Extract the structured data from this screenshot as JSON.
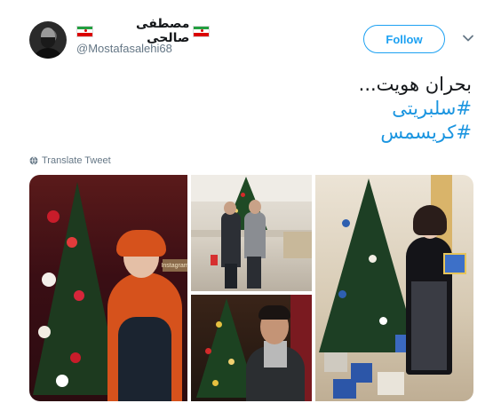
{
  "user": {
    "display_name": "مصطفی صالحی",
    "handle": "@Mostafasalehi68",
    "flag_icon": "iran-flag-icon"
  },
  "actions": {
    "follow_label": "Follow",
    "menu_icon": "chevron-down-icon"
  },
  "tweet": {
    "text": "بحران هویت...",
    "hashtags": [
      "#سلبریتی",
      "#کریسمس"
    ]
  },
  "translate": {
    "label": "Translate Tweet",
    "icon": "globe-icon"
  },
  "media": {
    "photos": [
      {
        "alt": "woman-with-orange-scarf-by-christmas-tree",
        "sign_text": "Instagram"
      },
      {
        "alt": "two-men-in-mall-with-christmas-tree"
      },
      {
        "alt": "man-by-christmas-tree"
      },
      {
        "alt": "woman-holding-gift-by-christmas-tree"
      }
    ]
  },
  "colors": {
    "link": "#1b95e0",
    "follow_border": "#1da1f2",
    "muted": "#657786"
  }
}
